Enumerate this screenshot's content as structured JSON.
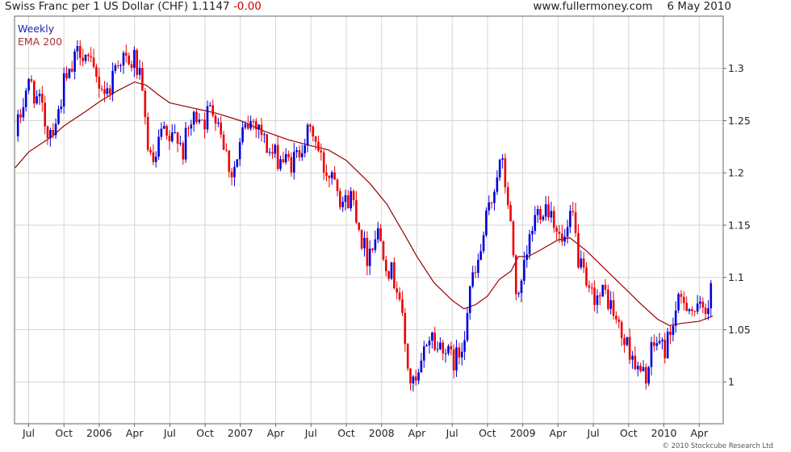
{
  "header": {
    "title": "Swiss Franc per 1 US Dollar (CHF)",
    "last": "1.1147",
    "change": "-0.00",
    "site": "www.fullermoney.com",
    "date": "6 May 2010"
  },
  "credit": "© 2010 Stockcube Research Ltd",
  "colors": {
    "up": "#0000dd",
    "down": "#ee0000",
    "ema": "#990000",
    "grid": "#d6d6d6",
    "legend_weekly": "#2222aa",
    "legend_ema": "#aa3333"
  },
  "chart_data": {
    "type": "candlestick",
    "legend": [
      "Weekly",
      "EMA 200"
    ],
    "legend_placement": "top-left",
    "ylim": [
      0.96,
      1.35
    ],
    "y_ticks": [
      1,
      1.05,
      1.1,
      1.15,
      1.2,
      1.25,
      1.3
    ],
    "y_tick_labels": [
      "1",
      "1.05",
      "1.1",
      "1.15",
      "1.2",
      "1.25",
      "1.3"
    ],
    "x_ticks": [
      "Jul",
      "Oct",
      "2006",
      "Apr",
      "Jul",
      "Oct",
      "2007",
      "Apr",
      "Jul",
      "Oct",
      "2008",
      "Apr",
      "Jul",
      "Oct",
      "2009",
      "Apr",
      "Jul",
      "Oct",
      "2010",
      "Apr"
    ],
    "x_tick_times": [
      2005.5,
      2005.75,
      2006.0,
      2006.25,
      2006.5,
      2006.75,
      2007.0,
      2007.25,
      2007.5,
      2007.75,
      2008.0,
      2008.25,
      2008.5,
      2008.75,
      2009.0,
      2009.25,
      2009.5,
      2009.75,
      2010.0,
      2010.25
    ],
    "xlim": [
      2005.4,
      2010.42
    ],
    "grid": true,
    "close_path": [
      [
        "2005-05-27",
        1.235
      ],
      [
        "2005-06-10",
        1.255
      ],
      [
        "2005-06-24",
        1.28
      ],
      [
        "2005-07-08",
        1.285
      ],
      [
        "2005-07-22",
        1.27
      ],
      [
        "2005-08-05",
        1.26
      ],
      [
        "2005-08-19",
        1.24
      ],
      [
        "2005-09-02",
        1.245
      ],
      [
        "2005-09-16",
        1.255
      ],
      [
        "2005-09-30",
        1.285
      ],
      [
        "2005-10-14",
        1.29
      ],
      [
        "2005-10-28",
        1.305
      ],
      [
        "2005-11-11",
        1.32
      ],
      [
        "2005-11-25",
        1.315
      ],
      [
        "2005-12-09",
        1.3
      ],
      [
        "2005-12-23",
        1.29
      ],
      [
        "2006-01-06",
        1.285
      ],
      [
        "2006-01-20",
        1.275
      ],
      [
        "2006-02-03",
        1.29
      ],
      [
        "2006-02-17",
        1.31
      ],
      [
        "2006-03-03",
        1.31
      ],
      [
        "2006-03-17",
        1.3
      ],
      [
        "2006-03-31",
        1.31
      ],
      [
        "2006-04-14",
        1.29
      ],
      [
        "2006-04-28",
        1.25
      ],
      [
        "2006-05-12",
        1.21
      ],
      [
        "2006-05-26",
        1.21
      ],
      [
        "2006-06-09",
        1.24
      ],
      [
        "2006-06-23",
        1.23
      ],
      [
        "2006-07-07",
        1.23
      ],
      [
        "2006-07-21",
        1.24
      ],
      [
        "2006-08-04",
        1.22
      ],
      [
        "2006-08-18",
        1.24
      ],
      [
        "2006-09-01",
        1.25
      ],
      [
        "2006-09-15",
        1.26
      ],
      [
        "2006-09-29",
        1.25
      ],
      [
        "2006-10-13",
        1.26
      ],
      [
        "2006-10-27",
        1.26
      ],
      [
        "2006-11-10",
        1.245
      ],
      [
        "2006-11-24",
        1.22
      ],
      [
        "2006-12-08",
        1.2
      ],
      [
        "2006-12-22",
        1.21
      ],
      [
        "2007-01-05",
        1.235
      ],
      [
        "2007-01-19",
        1.245
      ],
      [
        "2007-02-02",
        1.25
      ],
      [
        "2007-02-16",
        1.25
      ],
      [
        "2007-03-02",
        1.23
      ],
      [
        "2007-03-16",
        1.22
      ],
      [
        "2007-03-30",
        1.215
      ],
      [
        "2007-04-13",
        1.215
      ],
      [
        "2007-04-27",
        1.21
      ],
      [
        "2007-05-11",
        1.21
      ],
      [
        "2007-05-25",
        1.215
      ],
      [
        "2007-06-08",
        1.23
      ],
      [
        "2007-06-22",
        1.235
      ],
      [
        "2007-07-06",
        1.24
      ],
      [
        "2007-07-20",
        1.22
      ],
      [
        "2007-08-03",
        1.205
      ],
      [
        "2007-08-17",
        1.2
      ],
      [
        "2007-08-31",
        1.205
      ],
      [
        "2007-09-14",
        1.18
      ],
      [
        "2007-09-28",
        1.17
      ],
      [
        "2007-10-12",
        1.18
      ],
      [
        "2007-10-26",
        1.165
      ],
      [
        "2007-11-09",
        1.14
      ],
      [
        "2007-11-23",
        1.12
      ],
      [
        "2007-12-07",
        1.135
      ],
      [
        "2007-12-21",
        1.145
      ],
      [
        "2008-01-04",
        1.13
      ],
      [
        "2008-01-18",
        1.11
      ],
      [
        "2008-02-01",
        1.1
      ],
      [
        "2008-02-15",
        1.09
      ],
      [
        "2008-02-29",
        1.04
      ],
      [
        "2008-03-14",
        1.0
      ],
      [
        "2008-03-28",
        0.995
      ],
      [
        "2008-04-11",
        1.01
      ],
      [
        "2008-04-25",
        1.04
      ],
      [
        "2008-05-09",
        1.045
      ],
      [
        "2008-05-23",
        1.03
      ],
      [
        "2008-06-06",
        1.04
      ],
      [
        "2008-06-20",
        1.025
      ],
      [
        "2008-07-04",
        1.02
      ],
      [
        "2008-07-18",
        1.025
      ],
      [
        "2008-08-01",
        1.045
      ],
      [
        "2008-08-15",
        1.09
      ],
      [
        "2008-08-29",
        1.1
      ],
      [
        "2008-09-12",
        1.12
      ],
      [
        "2008-09-26",
        1.15
      ],
      [
        "2008-10-10",
        1.17
      ],
      [
        "2008-10-24",
        1.2
      ],
      [
        "2008-11-07",
        1.21
      ],
      [
        "2008-11-21",
        1.18
      ],
      [
        "2008-12-05",
        1.13
      ],
      [
        "2008-12-19",
        1.07
      ],
      [
        "2009-01-02",
        1.1
      ],
      [
        "2009-01-16",
        1.13
      ],
      [
        "2009-01-30",
        1.155
      ],
      [
        "2009-02-13",
        1.165
      ],
      [
        "2009-02-27",
        1.17
      ],
      [
        "2009-03-13",
        1.165
      ],
      [
        "2009-03-27",
        1.15
      ],
      [
        "2009-04-10",
        1.13
      ],
      [
        "2009-04-24",
        1.14
      ],
      [
        "2009-05-08",
        1.16
      ],
      [
        "2009-05-22",
        1.12
      ],
      [
        "2009-06-05",
        1.1
      ],
      [
        "2009-06-19",
        1.08
      ],
      [
        "2009-07-03",
        1.085
      ],
      [
        "2009-07-17",
        1.08
      ],
      [
        "2009-07-31",
        1.085
      ],
      [
        "2009-08-14",
        1.075
      ],
      [
        "2009-08-28",
        1.06
      ],
      [
        "2009-09-11",
        1.045
      ],
      [
        "2009-09-25",
        1.035
      ],
      [
        "2009-10-09",
        1.03
      ],
      [
        "2009-10-23",
        1.01
      ],
      [
        "2009-11-06",
        1.005
      ],
      [
        "2009-11-20",
        1.01
      ],
      [
        "2009-12-04",
        1.035
      ],
      [
        "2009-12-18",
        1.04
      ],
      [
        "2010-01-01",
        1.03
      ],
      [
        "2010-01-15",
        1.045
      ],
      [
        "2010-01-29",
        1.065
      ],
      [
        "2010-02-12",
        1.075
      ],
      [
        "2010-02-26",
        1.08
      ],
      [
        "2010-03-12",
        1.07
      ],
      [
        "2010-03-26",
        1.065
      ],
      [
        "2010-04-09",
        1.07
      ],
      [
        "2010-04-23",
        1.075
      ],
      [
        "2010-04-30",
        1.09
      ],
      [
        "2010-05-06",
        1.115
      ]
    ],
    "ema_200": [
      [
        "2005-05-27",
        1.205
      ],
      [
        "2005-07-01",
        1.22
      ],
      [
        "2005-09-01",
        1.235
      ],
      [
        "2005-10-01",
        1.245
      ],
      [
        "2005-12-01",
        1.26
      ],
      [
        "2006-01-01",
        1.268
      ],
      [
        "2006-02-15",
        1.278
      ],
      [
        "2006-04-01",
        1.287
      ],
      [
        "2006-05-01",
        1.284
      ],
      [
        "2006-06-01",
        1.275
      ],
      [
        "2006-07-01",
        1.267
      ],
      [
        "2006-09-01",
        1.262
      ],
      [
        "2006-11-01",
        1.257
      ],
      [
        "2007-01-01",
        1.25
      ],
      [
        "2007-03-01",
        1.24
      ],
      [
        "2007-05-01",
        1.232
      ],
      [
        "2007-07-01",
        1.226
      ],
      [
        "2007-08-15",
        1.222
      ],
      [
        "2007-10-01",
        1.212
      ],
      [
        "2007-12-01",
        1.19
      ],
      [
        "2008-01-15",
        1.17
      ],
      [
        "2008-03-01",
        1.14
      ],
      [
        "2008-04-01",
        1.12
      ],
      [
        "2008-05-15",
        1.095
      ],
      [
        "2008-07-01",
        1.078
      ],
      [
        "2008-08-01",
        1.07
      ],
      [
        "2008-09-01",
        1.074
      ],
      [
        "2008-10-01",
        1.082
      ],
      [
        "2008-11-01",
        1.098
      ],
      [
        "2008-12-01",
        1.106
      ],
      [
        "2008-12-20",
        1.12
      ],
      [
        "2009-01-15",
        1.12
      ],
      [
        "2009-02-15",
        1.126
      ],
      [
        "2009-04-01",
        1.136
      ],
      [
        "2009-05-01",
        1.138
      ],
      [
        "2009-06-15",
        1.125
      ],
      [
        "2009-08-01",
        1.108
      ],
      [
        "2009-09-15",
        1.092
      ],
      [
        "2009-11-01",
        1.075
      ],
      [
        "2009-12-15",
        1.06
      ],
      [
        "2010-01-15",
        1.054
      ],
      [
        "2010-02-15",
        1.056
      ],
      [
        "2010-04-01",
        1.058
      ],
      [
        "2010-05-06",
        1.063
      ]
    ]
  }
}
